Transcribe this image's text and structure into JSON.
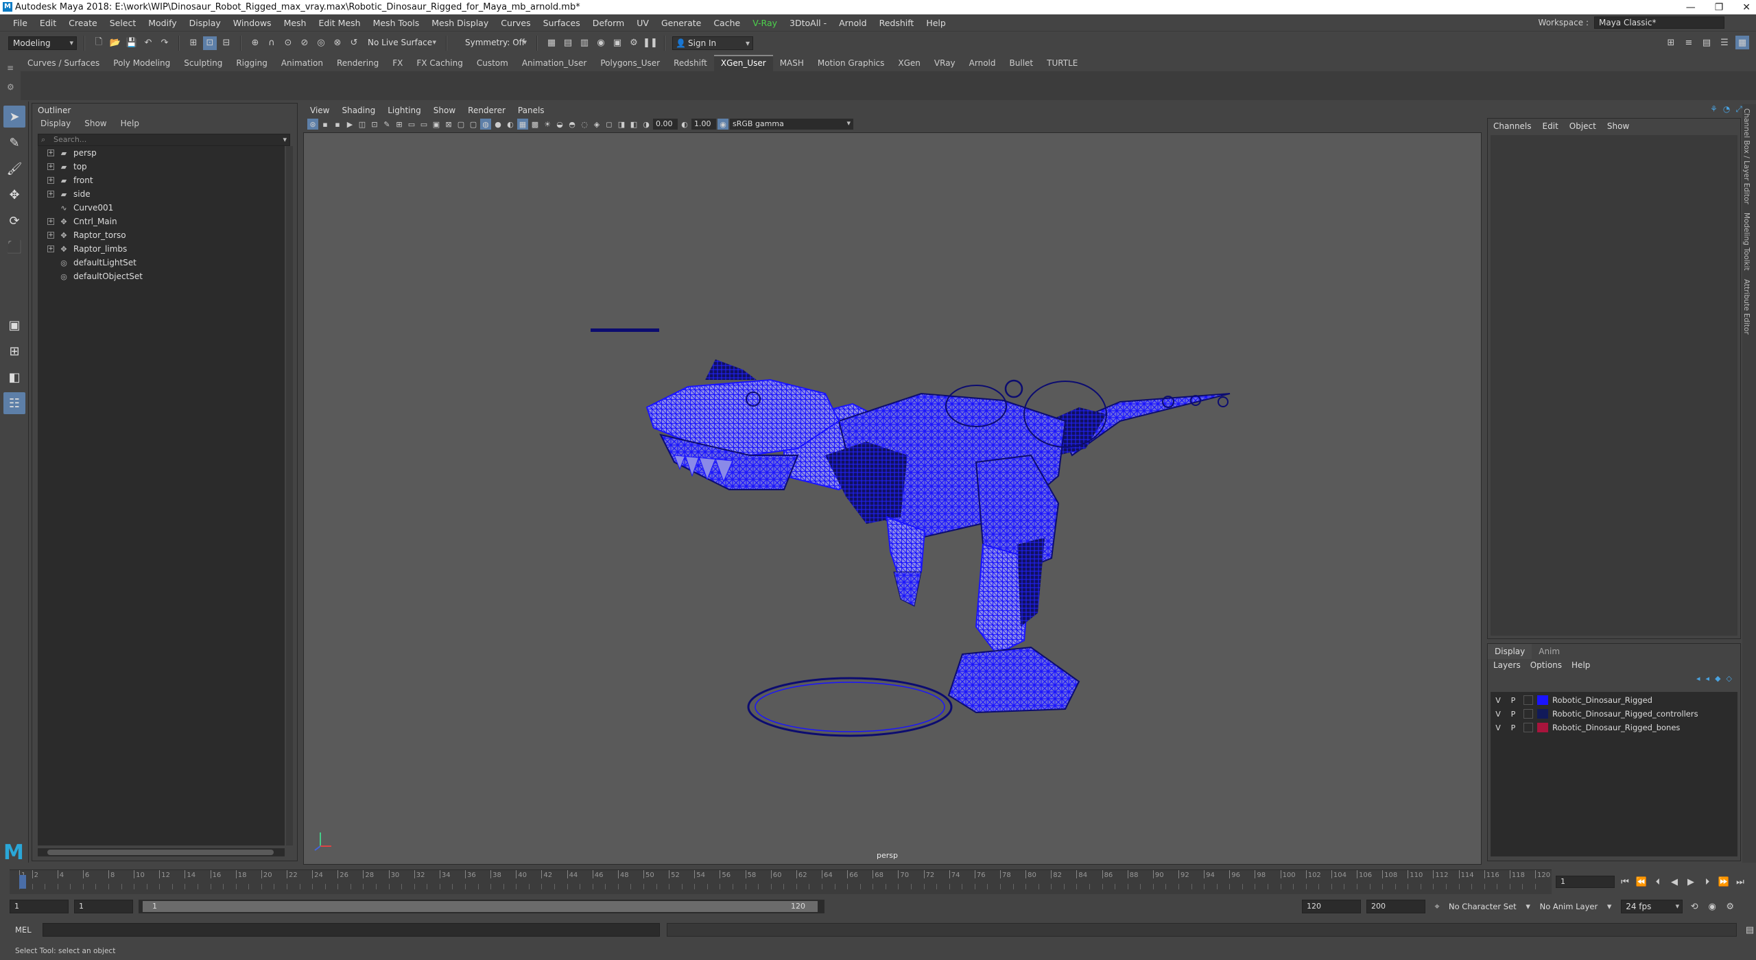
{
  "titlebar": {
    "title": "Autodesk Maya 2018: E:\\work\\WIP\\Dinosaur_Robot_Rigged_max_vray.max\\Robotic_Dinosaur_Rigged_for_Maya_mb_arnold.mb*"
  },
  "menubar": {
    "items": [
      "File",
      "Edit",
      "Create",
      "Select",
      "Modify",
      "Display",
      "Windows",
      "Mesh",
      "Edit Mesh",
      "Mesh Tools",
      "Mesh Display",
      "Curves",
      "Surfaces",
      "Deform",
      "UV",
      "Generate",
      "Cache",
      "V-Ray",
      "3DtoAll -",
      "Arnold",
      "Redshift",
      "Help"
    ],
    "workspace_label": "Workspace :",
    "workspace_value": "Maya Classic*"
  },
  "statusline": {
    "mode": "Modeling",
    "live_surface": "No Live Surface",
    "symmetry": "Symmetry: Off",
    "sign_in": "Sign In"
  },
  "shelf": {
    "tabs": [
      "Curves / Surfaces",
      "Poly Modeling",
      "Sculpting",
      "Rigging",
      "Animation",
      "Rendering",
      "FX",
      "FX Caching",
      "Custom",
      "Animation_User",
      "Polygons_User",
      "Redshift",
      "XGen_User",
      "MASH",
      "Motion Graphics",
      "XGen",
      "VRay",
      "Arnold",
      "Bullet",
      "TURTLE"
    ],
    "active": "XGen_User"
  },
  "outliner": {
    "title": "Outliner",
    "menu": [
      "Display",
      "Show",
      "Help"
    ],
    "search_placeholder": "Search...",
    "nodes": [
      {
        "label": "persp",
        "expand": true,
        "icon": "camera-icon"
      },
      {
        "label": "top",
        "expand": true,
        "icon": "camera-icon"
      },
      {
        "label": "front",
        "expand": true,
        "icon": "camera-icon"
      },
      {
        "label": "side",
        "expand": true,
        "icon": "camera-icon"
      },
      {
        "label": "Curve001",
        "expand": false,
        "icon": "curve-icon"
      },
      {
        "label": "Cntrl_Main",
        "expand": true,
        "icon": "transform-icon"
      },
      {
        "label": "Raptor_torso",
        "expand": true,
        "icon": "transform-icon"
      },
      {
        "label": "Raptor_limbs",
        "expand": true,
        "icon": "transform-icon"
      },
      {
        "label": "defaultLightSet",
        "expand": false,
        "icon": "set-icon"
      },
      {
        "label": "defaultObjectSet",
        "expand": false,
        "icon": "set-icon"
      }
    ]
  },
  "viewport": {
    "menu": [
      "View",
      "Shading",
      "Lighting",
      "Show",
      "Renderer",
      "Panels"
    ],
    "exposure": "0.00",
    "gamma": "1.00",
    "colorspace": "sRGB gamma",
    "camera": "persp",
    "wire_color": "#1a14ff"
  },
  "channelbox": {
    "menu": [
      "Channels",
      "Edit",
      "Object",
      "Show"
    ]
  },
  "layereditor": {
    "tabs": [
      "Display",
      "Anim"
    ],
    "active": "Display",
    "menu": [
      "Layers",
      "Options",
      "Help"
    ],
    "layers": [
      {
        "v": "V",
        "p": "P",
        "name": "Robotic_Dinosaur_Rigged",
        "color": "#1a14ff"
      },
      {
        "v": "V",
        "p": "P",
        "name": "Robotic_Dinosaur_Rigged_controllers",
        "color": "#111a5a"
      },
      {
        "v": "V",
        "p": "P",
        "name": "Robotic_Dinosaur_Rigged_bones",
        "color": "#a8143c"
      }
    ]
  },
  "sidetabs": [
    "Channel Box / Layer Editor",
    "Modeling Toolkit",
    "Attribute Editor"
  ],
  "timeline": {
    "ticks": [
      "1",
      "2",
      "4",
      "6",
      "8",
      "10",
      "12",
      "14",
      "16",
      "18",
      "20",
      "22",
      "24",
      "26",
      "28",
      "30",
      "32",
      "34",
      "36",
      "38",
      "40",
      "42",
      "44",
      "46",
      "48",
      "50",
      "52",
      "54",
      "56",
      "58",
      "60",
      "62",
      "64",
      "66",
      "68",
      "70",
      "72",
      "74",
      "76",
      "78",
      "80",
      "82",
      "84",
      "86",
      "88",
      "90",
      "92",
      "94",
      "96",
      "98",
      "100",
      "102",
      "104",
      "106",
      "108",
      "110",
      "112",
      "114",
      "116",
      "118",
      "120"
    ],
    "current_frame": "1"
  },
  "range": {
    "start": "1",
    "anim_start": "1",
    "range_start": "1",
    "range_end": "120",
    "anim_end": "120",
    "end": "200",
    "character_set": "No Character Set",
    "anim_layer": "No Anim Layer",
    "fps": "24 fps"
  },
  "cmdline": {
    "label": "MEL"
  },
  "helpline": {
    "text": "Select Tool: select an object"
  }
}
